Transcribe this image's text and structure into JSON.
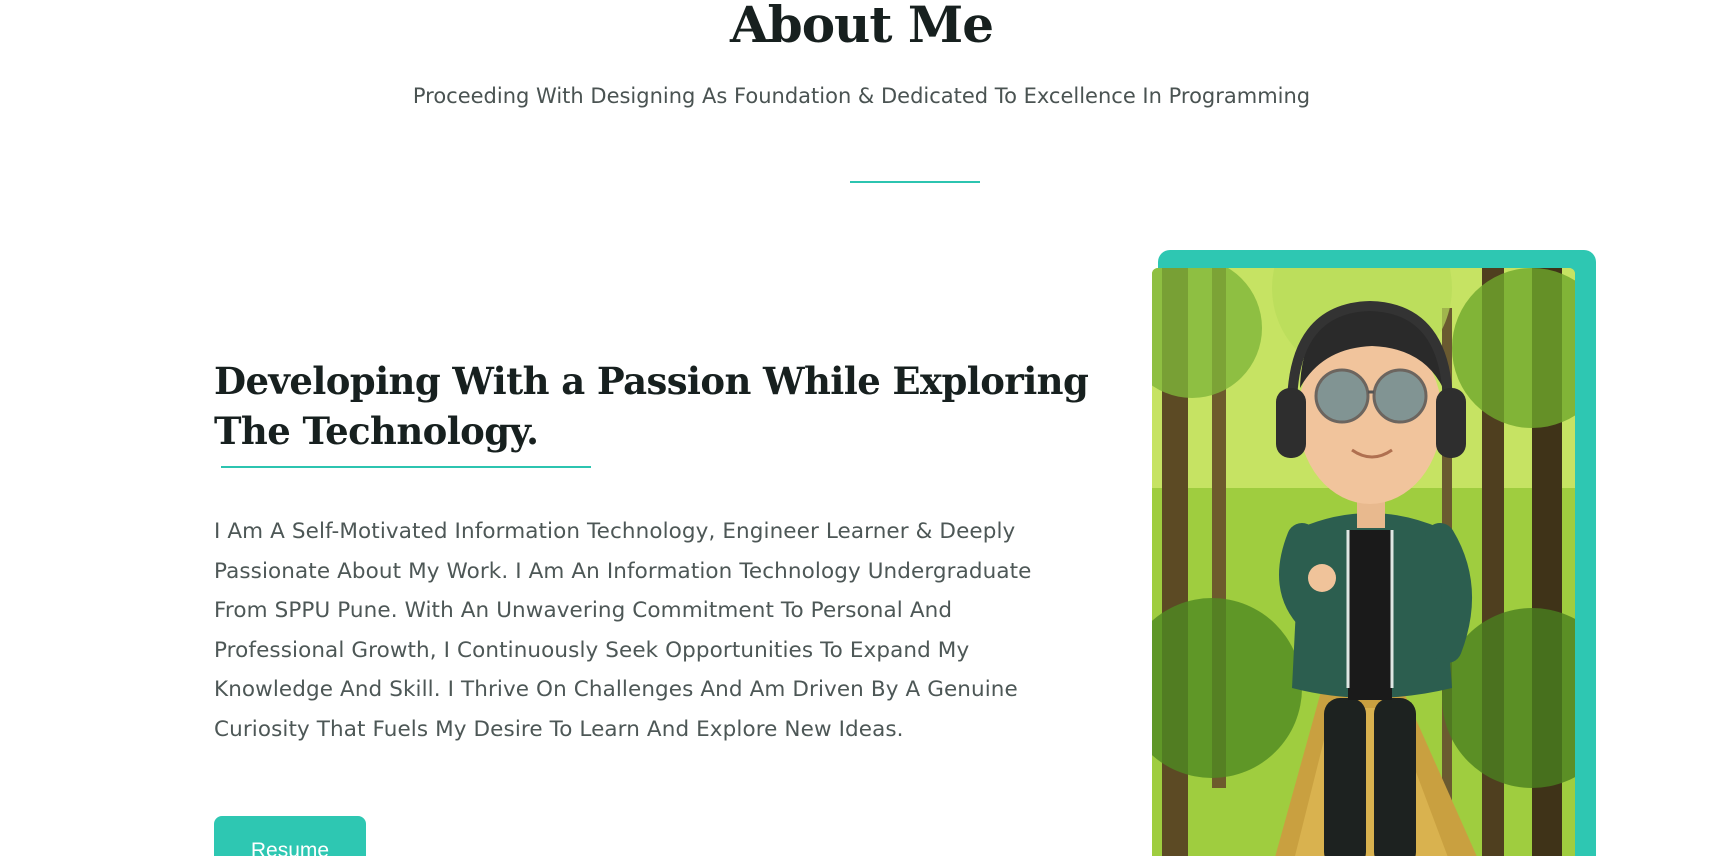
{
  "about": {
    "title": "About Me",
    "subtitle": "Proceeding With Designing As Foundation & Dedicated To Excellence In Programming"
  },
  "intro": {
    "headline": "Developing With a Passion While Exploring The Technology.",
    "bio": "I Am A Self-Motivated Information Technology, Engineer Learner & Deeply Passionate About My Work.  I Am An Information Technology Undergraduate From SPPU Pune. With An Unwavering Commitment To Personal And Professional Growth, I Continuously Seek Opportunities To Expand My Knowledge And Skill. I Thrive On Challenges And Am Driven By A Genuine Curiosity That Fuels My Desire To Learn And Explore New Ideas.",
    "resume_label": "Resume"
  },
  "colors": {
    "accent": "#2ec7b2",
    "heading": "#17201f",
    "body_text": "#4d5756"
  },
  "portrait": {
    "description_icon": "avatar-in-forest-image"
  }
}
